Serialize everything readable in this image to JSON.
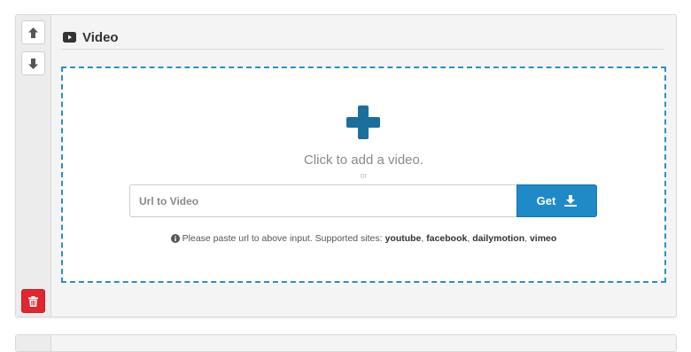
{
  "block": {
    "title": "Video",
    "icon": "video-icon"
  },
  "sidebar": {
    "move_up_icon": "arrow-up-icon",
    "move_down_icon": "arrow-down-icon",
    "delete_icon": "trash-icon"
  },
  "dropzone": {
    "add_icon": "plus-icon",
    "click_text": "Click to add a video.",
    "or_text": "or"
  },
  "url_form": {
    "placeholder": "Url to Video",
    "value": "",
    "get_label": "Get",
    "get_icon": "download-icon"
  },
  "help": {
    "icon": "info-circle-icon",
    "prefix": "Please paste url to above input. Supported sites:",
    "sites": [
      "youtube",
      "facebook",
      "dailymotion",
      "vimeo"
    ]
  },
  "colors": {
    "accent": "#1e8ac7",
    "danger": "#e0262f",
    "border_dashed": "#2b8fbf"
  }
}
